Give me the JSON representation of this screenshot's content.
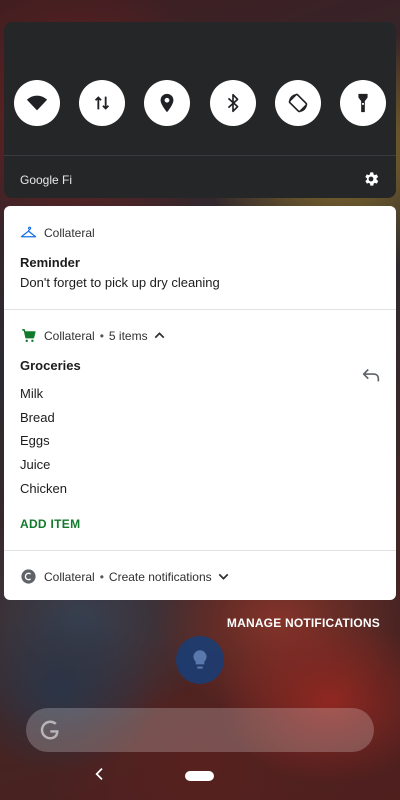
{
  "quick_settings": {
    "tiles": [
      {
        "name": "wifi-icon"
      },
      {
        "name": "mobile-data-icon"
      },
      {
        "name": "location-icon"
      },
      {
        "name": "bluetooth-icon"
      },
      {
        "name": "auto-rotate-icon"
      },
      {
        "name": "flashlight-icon"
      }
    ],
    "carrier": "Google Fi"
  },
  "notifications": {
    "reminder": {
      "app_name": "Collateral",
      "title": "Reminder",
      "body": "Don't forget to pick up dry cleaning"
    },
    "groceries": {
      "app_name": "Collateral",
      "separator": "•",
      "count": "5 items",
      "title": "Groceries",
      "items": [
        "Milk",
        "Bread",
        "Eggs",
        "Juice",
        "Chicken"
      ],
      "action": "ADD ITEM"
    },
    "collapsed": {
      "app_name": "Collateral",
      "separator": "•",
      "channel": "Create notifications"
    }
  },
  "manage_notifications": "MANAGE NOTIFICATIONS",
  "colors": {
    "accent_green": "#137a2c",
    "accent_blue": "#1a73e8",
    "panel_bg": "#252628"
  }
}
